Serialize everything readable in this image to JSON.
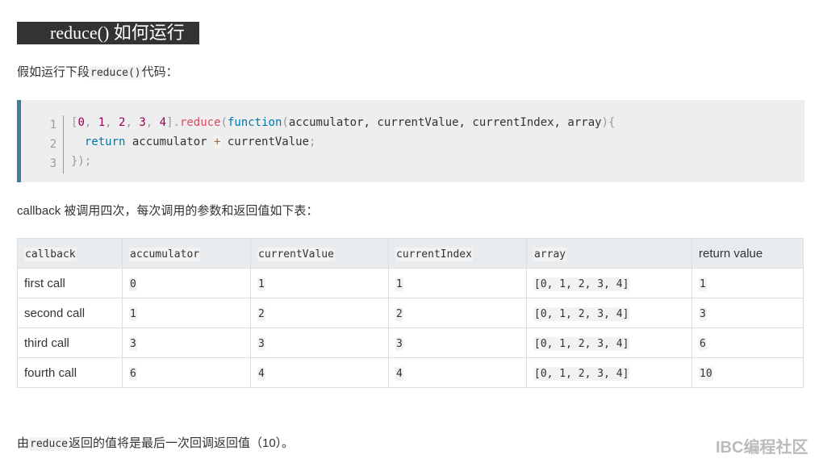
{
  "heading": "reduce() 如何运行",
  "intro": {
    "before": "假如运行下段",
    "code": "reduce()",
    "after": "代码："
  },
  "code_block": {
    "line_numbers": [
      "1",
      "2",
      "3"
    ],
    "line1": {
      "open": "[",
      "n0": "0",
      "c1": ", ",
      "n1": "1",
      "c2": ", ",
      "n2": "2",
      "c3": ", ",
      "n3": "3",
      "c4": ", ",
      "n4": "4",
      "close": "]",
      "dot": ".",
      "method": "reduce",
      "p1": "(",
      "kw": "function",
      "p2": "(",
      "args": "accumulator, currentValue, currentIndex, array",
      "p3": "){"
    },
    "line2": {
      "indent": "  ",
      "kw": "return",
      "a": " accumulator ",
      "op": "+",
      "b": " currentValue",
      "semi": ";"
    },
    "line3": {
      "text": "});"
    }
  },
  "desc": "callback 被调用四次，每次调用的参数和返回值如下表：",
  "table": {
    "headers": [
      "callback",
      "accumulator",
      "currentValue",
      "currentIndex",
      "array",
      "return value"
    ],
    "rows": [
      [
        "first call",
        "0",
        "1",
        "1",
        "[0, 1, 2, 3, 4]",
        "1"
      ],
      [
        "second call",
        "1",
        "2",
        "2",
        "[0, 1, 2, 3, 4]",
        "3"
      ],
      [
        "third call",
        "3",
        "3",
        "3",
        "[0, 1, 2, 3, 4]",
        "6"
      ],
      [
        "fourth call",
        "6",
        "4",
        "4",
        "[0, 1, 2, 3, 4]",
        "10"
      ]
    ]
  },
  "footer": {
    "before": "由",
    "code": "reduce",
    "after": "返回的值将是最后一次回调返回值（10）。"
  },
  "watermark": "IBC编程社区"
}
